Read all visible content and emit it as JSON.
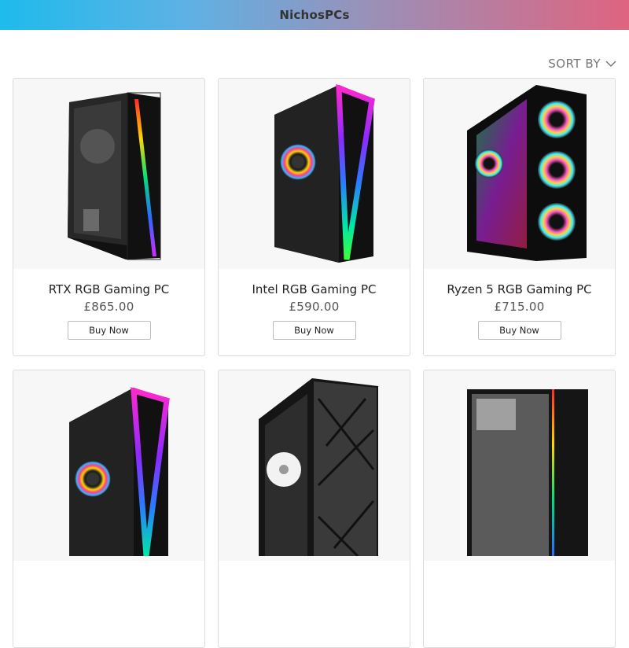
{
  "header": {
    "brand": "NichosPCs",
    "accent_start": "#1ebbec",
    "accent_end": "#df6480"
  },
  "toolbar": {
    "sort_label": "SORT BY",
    "sort_icon": "chevron-down-icon"
  },
  "products": [
    {
      "name": "RTX RGB Gaming PC",
      "price": "£865.00",
      "button": "Buy Now"
    },
    {
      "name": "Intel RGB Gaming PC",
      "price": "£590.00",
      "button": "Buy Now"
    },
    {
      "name": "Ryzen 5 RGB Gaming PC",
      "price": "£715.00",
      "button": "Buy Now"
    },
    {
      "name": "",
      "price": "",
      "button": ""
    },
    {
      "name": "",
      "price": "",
      "button": ""
    },
    {
      "name": "",
      "price": "",
      "button": ""
    }
  ]
}
